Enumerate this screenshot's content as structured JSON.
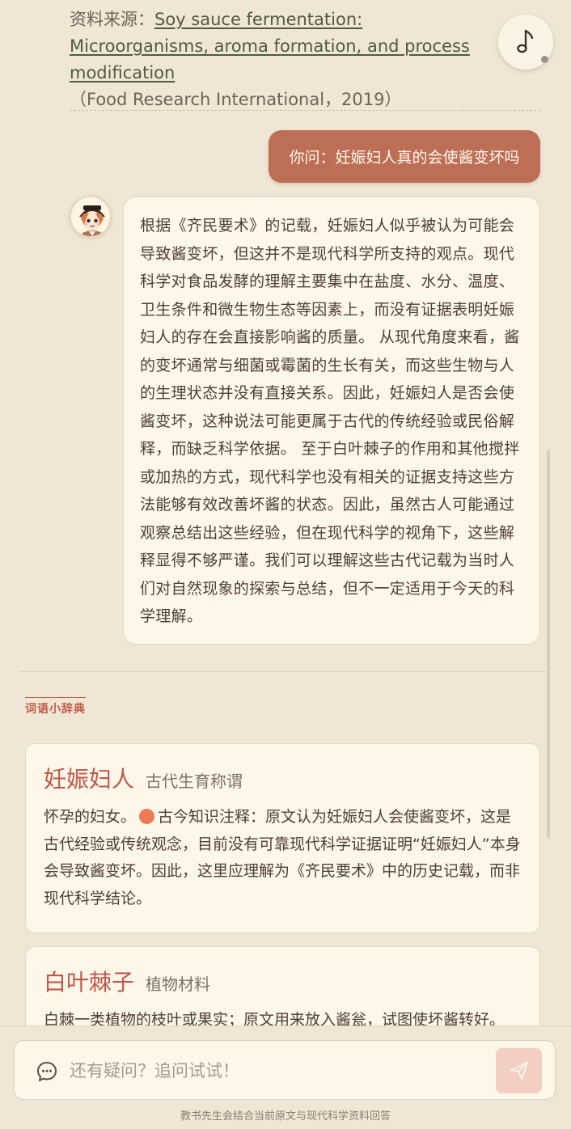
{
  "source": {
    "prefix_partial": "资料来源：",
    "link_text": "Soy sauce fermentation: Microorganisms, aroma formation, and process modification",
    "suffix": "（Food Research International，2019）"
  },
  "conversation": {
    "user_question": "你问：妊娠妇人真的会使酱变坏吗",
    "answer": "根据《齐民要术》的记载，妊娠妇人似乎被认为可能会导致酱变坏，但这并不是现代科学所支持的观点。现代科学对食品发酵的理解主要集中在盐度、水分、温度、卫生条件和微生物生态等因素上，而没有证据表明妊娠妇人的存在会直接影响酱的质量。 从现代角度来看，酱的变坏通常与细菌或霉菌的生长有关，而这些生物与人的生理状态并没有直接关系。因此，妊娠妇人是否会使酱变坏，这种说法可能更属于古代的传统经验或民俗解释，而缺乏科学依据。 至于白叶棘子的作用和其他搅拌或加热的方式，现代科学也没有相关的证据支持这些方法能够有效改善坏酱的状态。因此，虽然古人可能通过观察总结出这些经验，但在现代科学的视角下，这些解释显得不够严谨。我们可以理解这些古代记载为当时人们对自然现象的探索与总结，但不一定适用于今天的科学理解。"
  },
  "dictionary": {
    "title": "词语小辞典",
    "entries": [
      {
        "term": "妊娠妇人",
        "category": "古代生育称谓",
        "def_before": "怀孕的妇女。",
        "def_after": "古今知识注释：原文认为妊娠妇人会使酱变坏，这是古代经验或传统观念，目前没有可靠现代科学证据证明“妊娠妇人”本身会导致酱变坏。因此，这里应理解为《齐民要术》中的历史记载，而非现代科学结论。"
      },
      {
        "term": "白叶棘子",
        "category": "植物材料",
        "def": "白棘一类植物的枝叶或果实；原文用来放入酱瓮，试图使坏酱转好。"
      }
    ]
  },
  "input": {
    "placeholder": "还有疑问？追问试试！"
  },
  "footer_note": "教书先生会结合当前原文与现代科学资料回答",
  "icons": {
    "music": "music-note-icon",
    "chat": "chat-bubble-icon",
    "send": "send-icon"
  },
  "colors": {
    "accent": "#bd6f55",
    "term": "#c0584a",
    "background": "#efe6d6",
    "card": "#fdf7ea"
  }
}
